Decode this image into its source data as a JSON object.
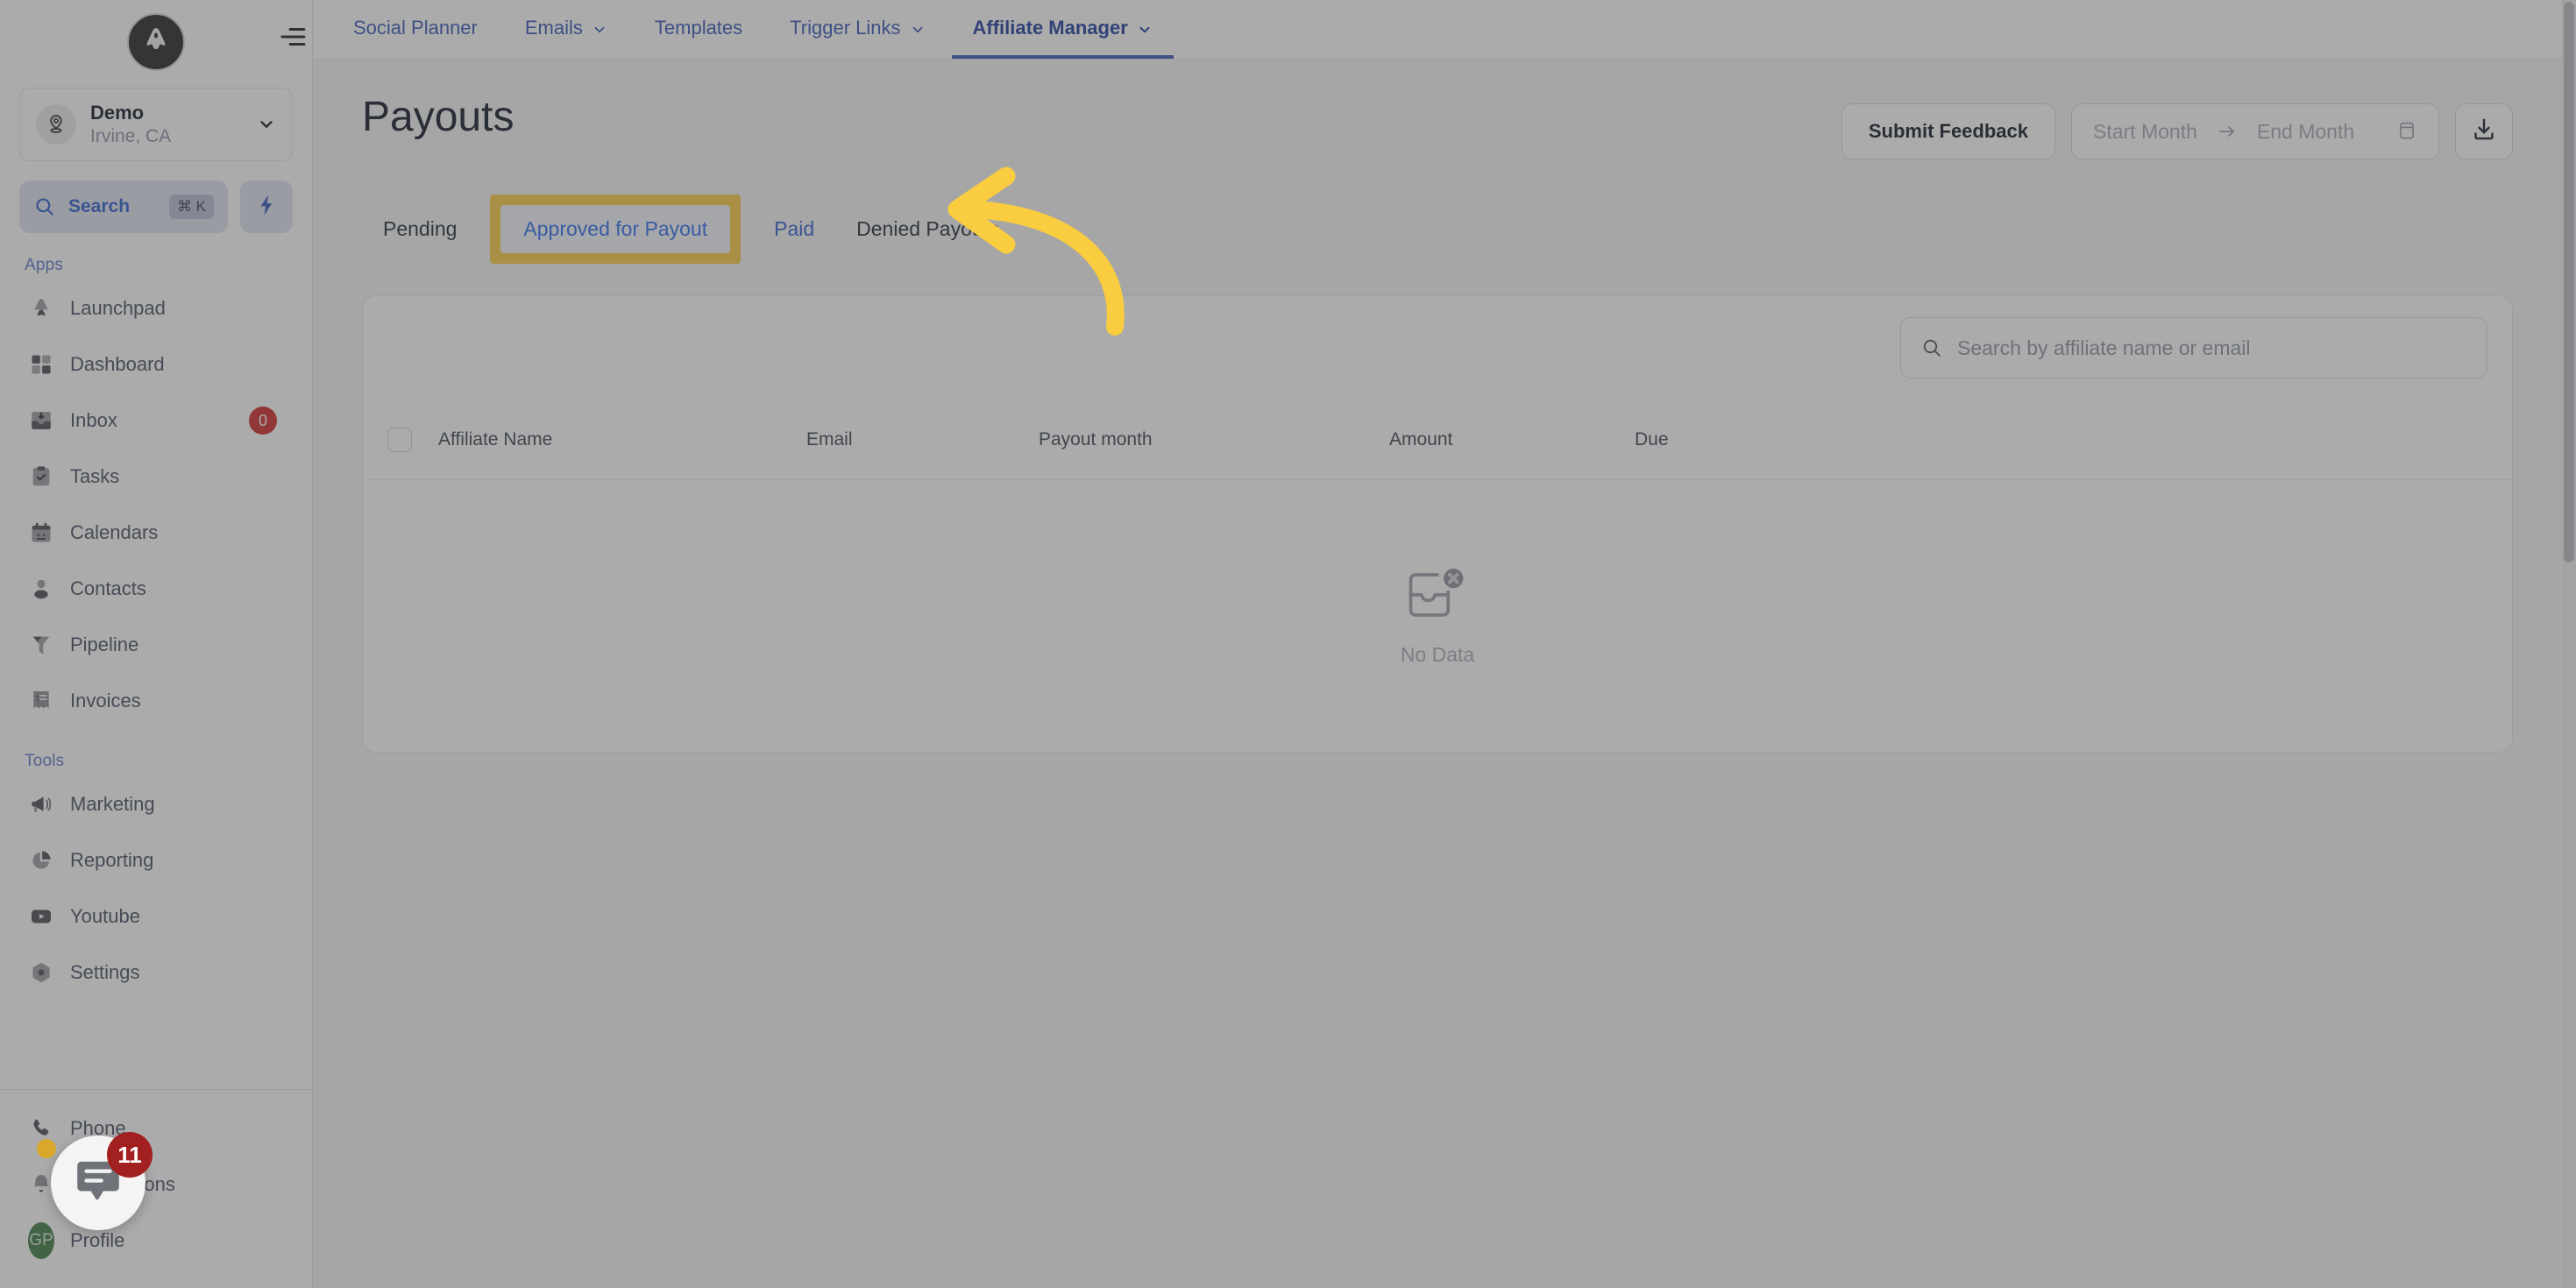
{
  "sidebar": {
    "logo_icon": "brand-a-logo",
    "location": {
      "icon": "map-pin-icon",
      "name": "Demo",
      "sublabel": "Irvine, CA",
      "chevron_icon": "chevron-down-icon"
    },
    "search": {
      "icon": "search-icon",
      "label": "Search",
      "shortcut": "⌘ K"
    },
    "quick_action_icon": "lightning-bolt-icon",
    "sections": [
      {
        "label": "Apps",
        "items": [
          {
            "label": "Launchpad",
            "icon": "rocket-icon",
            "badge": null
          },
          {
            "label": "Dashboard",
            "icon": "grid-icon",
            "badge": null
          },
          {
            "label": "Inbox",
            "icon": "inbox-icon",
            "badge": "0"
          },
          {
            "label": "Tasks",
            "icon": "clipboard-check-icon",
            "badge": null
          },
          {
            "label": "Calendars",
            "icon": "calendar-icon",
            "badge": null
          },
          {
            "label": "Contacts",
            "icon": "user-icon",
            "badge": null
          },
          {
            "label": "Pipeline",
            "icon": "funnel-icon",
            "badge": null
          },
          {
            "label": "Invoices",
            "icon": "invoice-icon",
            "badge": null
          }
        ]
      },
      {
        "label": "Tools",
        "items": [
          {
            "label": "Marketing",
            "icon": "megaphone-icon",
            "badge": null
          },
          {
            "label": "Reporting",
            "icon": "pie-chart-icon",
            "badge": null
          },
          {
            "label": "Youtube",
            "icon": "youtube-icon",
            "badge": null
          },
          {
            "label": "Settings",
            "icon": "gear-icon",
            "badge": null
          }
        ]
      }
    ],
    "footer": {
      "items": [
        {
          "label": "Phone",
          "icon": "phone-icon"
        },
        {
          "label": "Notifications",
          "icon": "bell-icon"
        },
        {
          "label": "Profile",
          "icon": "avatar-icon"
        }
      ],
      "avatar_initials": "GP"
    }
  },
  "collapse_icon": "collapse-menu-icon",
  "topnav": {
    "tabs": [
      {
        "label": "Social Planner",
        "has_caret": false,
        "active": false
      },
      {
        "label": "Emails",
        "has_caret": true,
        "active": false
      },
      {
        "label": "Templates",
        "has_caret": false,
        "active": false
      },
      {
        "label": "Trigger Links",
        "has_caret": true,
        "active": false
      },
      {
        "label": "Affiliate Manager",
        "has_caret": true,
        "active": true
      }
    ]
  },
  "page": {
    "title": "Payouts",
    "actions": {
      "submit_feedback_label": "Submit Feedback",
      "start_month_placeholder": "Start Month",
      "range_arrow_icon": "arrow-right-icon",
      "end_month_placeholder": "End Month",
      "calendar_icon": "calendar-icon",
      "download_icon": "download-icon"
    },
    "subtabs": [
      {
        "label": "Pending",
        "state": "normal"
      },
      {
        "label": "Approved for Payout",
        "state": "highlighted"
      },
      {
        "label": "Paid",
        "state": "link"
      },
      {
        "label": "Denied Payouts",
        "state": "normal"
      }
    ],
    "table": {
      "search_placeholder": "Search by affiliate name or email",
      "search_icon": "search-icon",
      "select_all_checkbox": false,
      "columns": [
        "Affiliate Name",
        "Email",
        "Payout month",
        "Amount",
        "Due"
      ],
      "rows": [],
      "empty_state": {
        "icon": "no-data-inbox-icon",
        "text": "No Data"
      }
    }
  },
  "annotation": {
    "arrow_icon": "curved-left-arrow-annotation",
    "color": "#facc3f",
    "highlight_color": "#facc3f"
  },
  "chat_widget": {
    "icon": "chat-bubble-icon",
    "badge_count": "11",
    "badge_color": "#a32020"
  }
}
